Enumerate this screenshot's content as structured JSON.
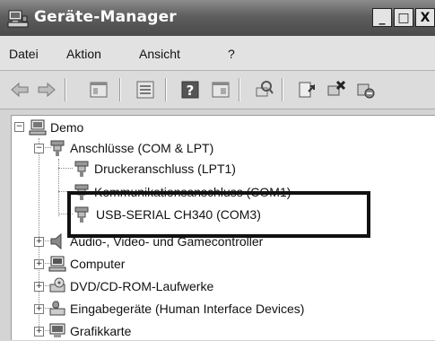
{
  "window": {
    "title": "Geräte-Manager",
    "minimize_label": "_",
    "maximize_label": "□",
    "close_label": "X"
  },
  "menu": {
    "items": [
      {
        "label": "Datei"
      },
      {
        "label": "Aktion"
      },
      {
        "label": "Ansicht"
      },
      {
        "label": "?"
      }
    ]
  },
  "toolbar": {
    "buttons": [
      "back-icon",
      "forward-icon",
      "properties-view-icon",
      "list-view-icon",
      "help-icon",
      "console-icon",
      "scan-hardware-icon",
      "update-driver-icon",
      "uninstall-icon",
      "disable-icon"
    ]
  },
  "tree": {
    "root": "Demo",
    "category_ports": "Anschlüsse (COM & LPT)",
    "port_1": "Druckeranschluss (LPT1)",
    "port_2": "Kommunikationsanschluss (COM1)",
    "port_3": "USB-SERIAL CH340 (COM3)",
    "category_audio": "Audio-, Video- und Gamecontroller",
    "category_computer": "Computer",
    "category_dvd": "DVD/CD-ROM-Laufwerke",
    "category_input": "Eingabegeräte (Human Interface Devices)",
    "category_graphics": "Grafikkarte"
  }
}
